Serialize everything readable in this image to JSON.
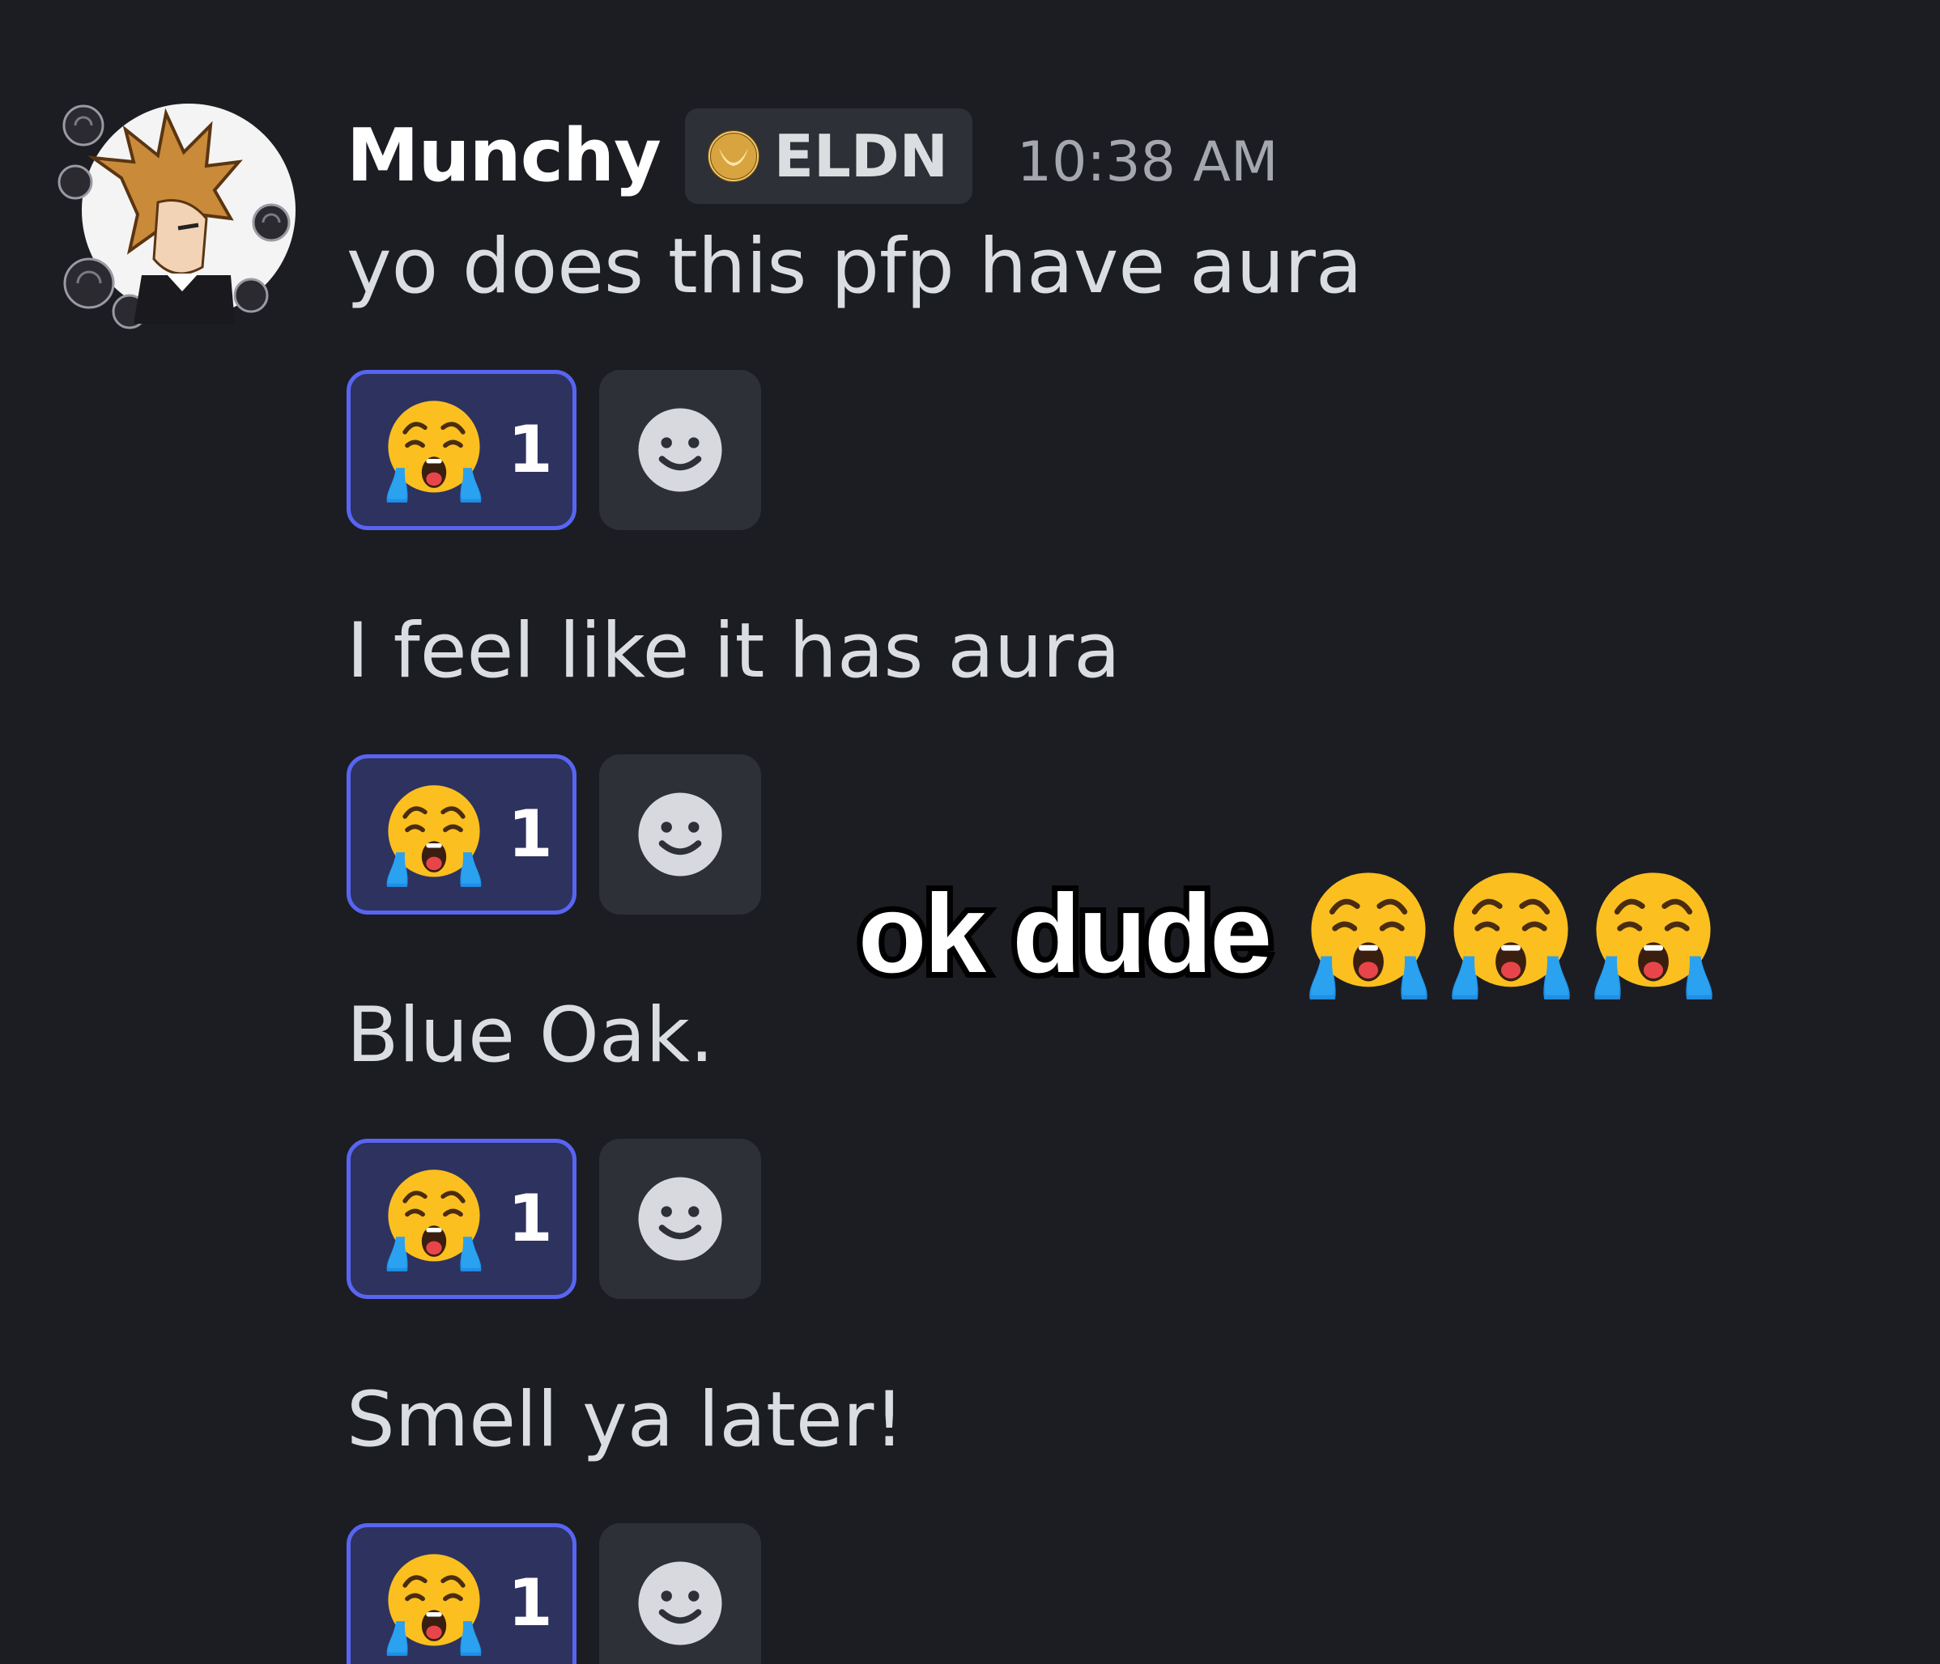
{
  "message_group": {
    "author": {
      "username": "Munchy",
      "avatar_icon": "avatar-spiky-hair-roses-icon",
      "guild_tag": {
        "icon": "crescent-badge-icon",
        "text": "ELDN"
      },
      "timestamp": "10:38 AM"
    },
    "messages": [
      {
        "text": "yo does this pfp have aura",
        "reaction": {
          "emoji": "loudly-crying-face-icon",
          "count": "1",
          "active": true
        }
      },
      {
        "text": "I feel like it has aura",
        "reaction": {
          "emoji": "loudly-crying-face-icon",
          "count": "1",
          "active": true
        }
      },
      {
        "text": "Blue Oak.",
        "reaction": {
          "emoji": "loudly-crying-face-icon",
          "count": "1",
          "active": true
        }
      },
      {
        "text": "Smell ya later!",
        "reaction": {
          "emoji": "loudly-crying-face-icon",
          "count": "1",
          "active": true
        }
      }
    ],
    "add_reaction_icon": "smiley-face-icon"
  },
  "overlay_caption": {
    "text": "ok dude",
    "emojis": [
      "loudly-crying-face-icon",
      "loudly-crying-face-icon",
      "loudly-crying-face-icon"
    ]
  },
  "colors": {
    "background": "#1c1d22",
    "username": "#ffffff",
    "message_text": "#dbdee1",
    "timestamp": "#a4a7ae",
    "reaction_border": "#5865f2",
    "reaction_fill": "#2d325f",
    "button_fill": "#2e3037"
  }
}
